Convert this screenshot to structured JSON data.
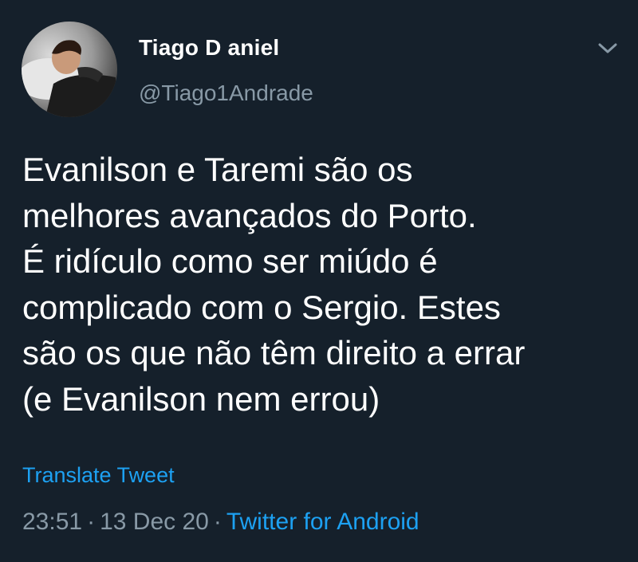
{
  "author": {
    "name": "Tiago D aniel",
    "handle": "@Tiago1Andrade"
  },
  "tweet": {
    "lines": [
      "Evanilson e Taremi são os",
      "melhores avançados do Porto.",
      "É ridículo como ser miúdo é",
      "complicado com o Sergio. Estes",
      "são os que não têm direito a errar",
      "(e Evanilson nem errou)"
    ],
    "translate_label": "Translate Tweet",
    "time": "23:51",
    "date": "13 Dec 20",
    "separator": "·",
    "source": "Twitter for Android"
  },
  "icons": {
    "menu": "chevron-down-icon"
  },
  "colors": {
    "background": "#15202b",
    "text": "#ffffff",
    "muted": "#8899a6",
    "link": "#1da1f2"
  }
}
